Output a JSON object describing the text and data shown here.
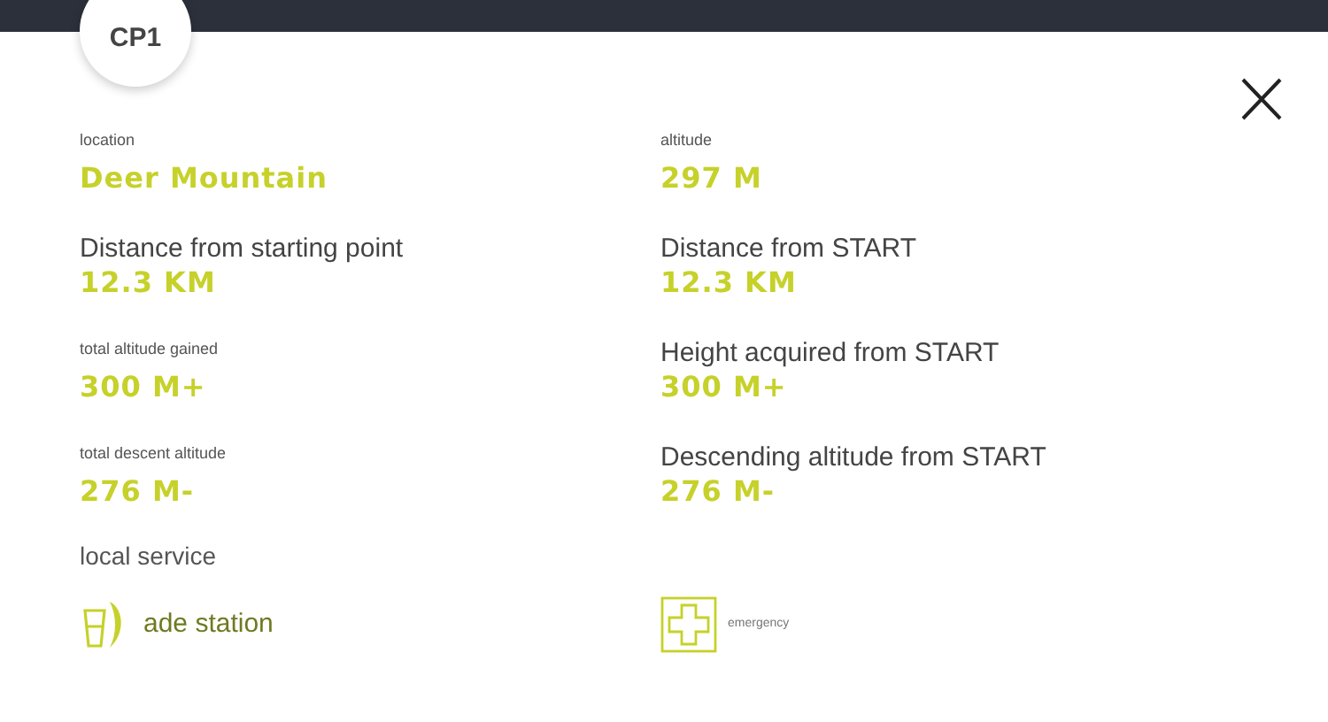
{
  "badge": "CP1",
  "fields": [
    {
      "kind": "small",
      "label": "location",
      "value": "Deer Mountain"
    },
    {
      "kind": "small",
      "label": "altitude",
      "value": "297 M"
    },
    {
      "kind": "large",
      "label": "Distance from starting point",
      "value": "12.3 KM"
    },
    {
      "kind": "large",
      "label": "Distance from START",
      "value": "12.3 KM"
    },
    {
      "kind": "small",
      "label": "total altitude gained",
      "value": "300 M+"
    },
    {
      "kind": "large",
      "label": "Height acquired from START",
      "value": "300 M+"
    },
    {
      "kind": "small",
      "label": "total descent altitude",
      "value": "276 M-"
    },
    {
      "kind": "large",
      "label": "Descending altitude from START",
      "value": "276 M-"
    }
  ],
  "services_heading": "local service",
  "services": [
    {
      "kind": "drink",
      "label": "ade station"
    },
    {
      "kind": "medical",
      "label": "emergency"
    }
  ]
}
